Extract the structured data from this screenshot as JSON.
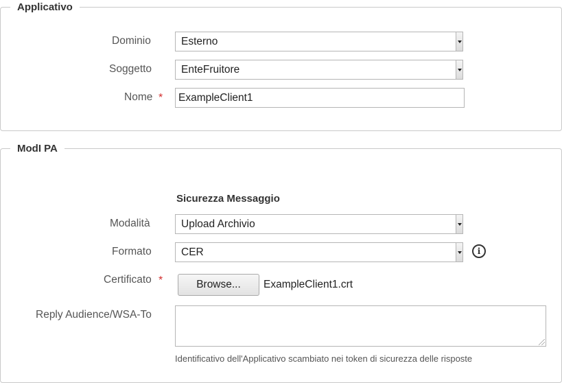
{
  "applicativo": {
    "legend": "Applicativo",
    "dominio": {
      "label": "Dominio",
      "value": "Esterno"
    },
    "soggetto": {
      "label": "Soggetto",
      "value": "EnteFruitore"
    },
    "nome": {
      "label": "Nome",
      "required_mark": "*",
      "value": "ExampleClient1"
    }
  },
  "modi": {
    "legend": "ModI PA",
    "section_title": "Sicurezza Messaggio",
    "modalita": {
      "label": "Modalità",
      "value": "Upload Archivio"
    },
    "formato": {
      "label": "Formato",
      "value": "CER",
      "info_icon": "info-icon"
    },
    "certificato": {
      "label": "Certificato",
      "required_mark": "*",
      "browse_label": "Browse...",
      "filename": "ExampleClient1.crt"
    },
    "reply_audience": {
      "label": "Reply Audience/WSA-To",
      "value": "",
      "hint": "Identificativo dell'Applicativo scambiato nei token di sicurezza delle risposte"
    }
  }
}
